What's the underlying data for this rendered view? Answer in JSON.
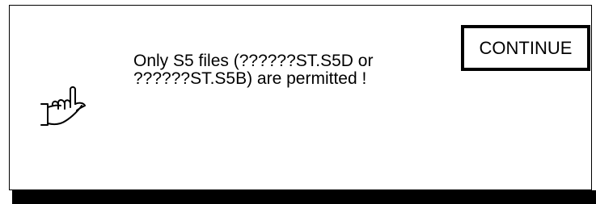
{
  "dialog": {
    "message_lines": [
      "Only S5 files (??????ST.S5D or",
      "??????ST.S5B) are permitted !"
    ],
    "continue_label": "CONTINUE",
    "icon": "pointing-hand-icon"
  }
}
